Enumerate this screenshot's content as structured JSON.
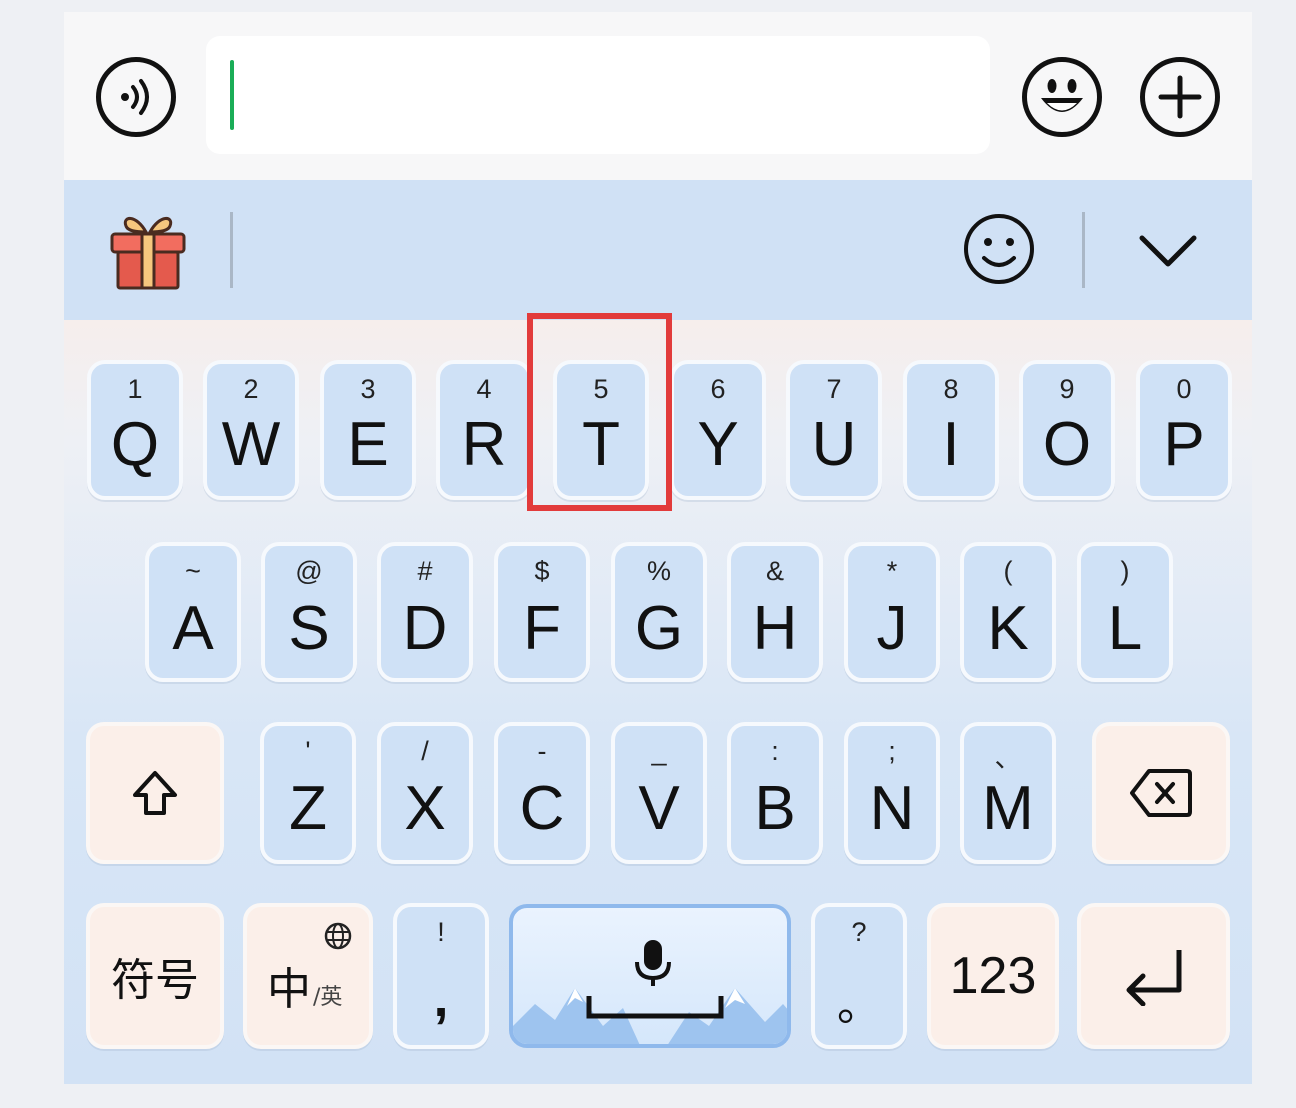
{
  "colors": {
    "accent_cursor": "#1aad57",
    "highlight_box": "#e23b3b",
    "key_blue": "#cfe1f6",
    "key_warm": "#fbefe9"
  },
  "input_bar": {
    "voice_icon": "voice-wave-icon",
    "text_value": "",
    "emoji_icon": "smiley-face-icon",
    "plus_icon": "plus-icon"
  },
  "toolbar": {
    "gift_icon": "gift-icon",
    "emoji_icon": "smiley-icon",
    "collapse_icon": "chevron-down-icon"
  },
  "rows": {
    "row1": [
      {
        "sub": "1",
        "main": "Q"
      },
      {
        "sub": "2",
        "main": "W"
      },
      {
        "sub": "3",
        "main": "E"
      },
      {
        "sub": "4",
        "main": "R"
      },
      {
        "sub": "5",
        "main": "T"
      },
      {
        "sub": "6",
        "main": "Y"
      },
      {
        "sub": "7",
        "main": "U"
      },
      {
        "sub": "8",
        "main": "I"
      },
      {
        "sub": "9",
        "main": "O"
      },
      {
        "sub": "0",
        "main": "P"
      }
    ],
    "row2": [
      {
        "sub": "~",
        "main": "A"
      },
      {
        "sub": "@",
        "main": "S"
      },
      {
        "sub": "#",
        "main": "D"
      },
      {
        "sub": "$",
        "main": "F"
      },
      {
        "sub": "%",
        "main": "G"
      },
      {
        "sub": "&",
        "main": "H"
      },
      {
        "sub": "*",
        "main": "J"
      },
      {
        "sub": "(",
        "main": "K"
      },
      {
        "sub": ")",
        "main": "L"
      }
    ],
    "row3": [
      {
        "sub": "'",
        "main": "Z"
      },
      {
        "sub": "/",
        "main": "X"
      },
      {
        "sub": "-",
        "main": "C"
      },
      {
        "sub": "_",
        "main": "V"
      },
      {
        "sub": ":",
        "main": "B"
      },
      {
        "sub": ";",
        "main": "N"
      },
      {
        "sub": "、",
        "main": "M"
      }
    ]
  },
  "bottom": {
    "symbols_label": "符号",
    "lang_main": "中",
    "lang_sub": "/英",
    "globe_icon": "globe-icon",
    "comma_sub": "!",
    "comma_main": ",",
    "space_icon": "microphone-icon",
    "period_sub": "?",
    "period_main": "。",
    "numbers_label": "123",
    "enter_icon": "enter-arrow-icon"
  },
  "shift_icon": "shift-arrow-icon",
  "backspace_icon": "backspace-icon",
  "highlighted_key": "T"
}
